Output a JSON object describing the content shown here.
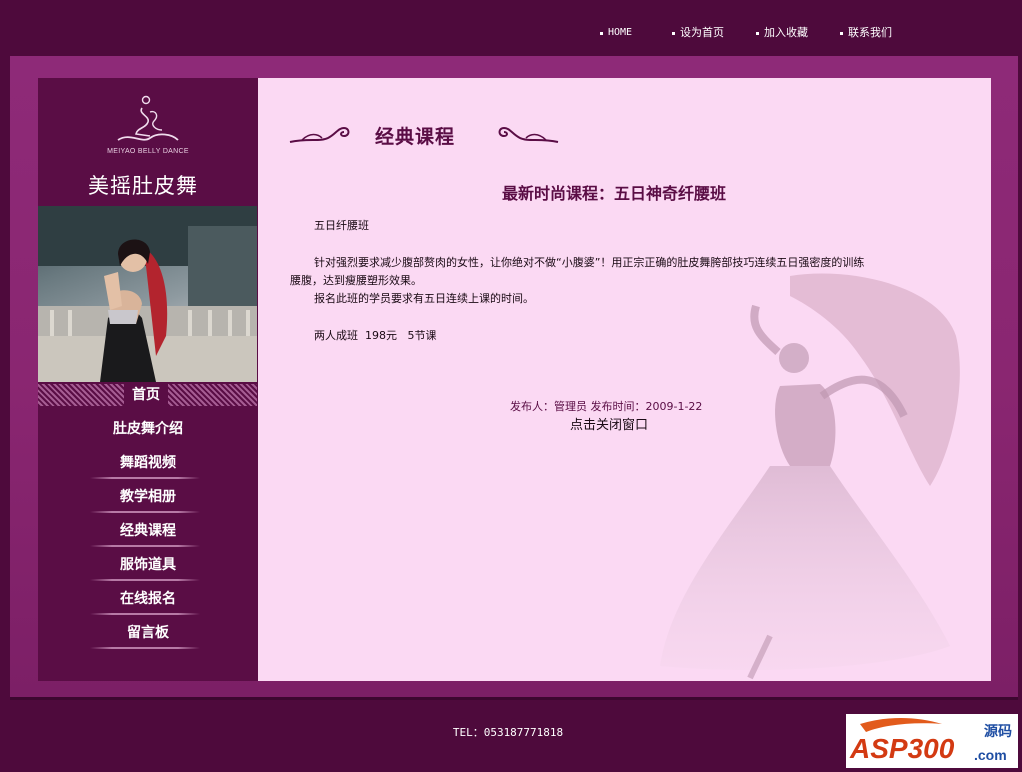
{
  "topnav": {
    "home": "HOME",
    "set_home": "设为首页",
    "favorite": "加入收藏",
    "contact": "联系我们"
  },
  "brand": {
    "logo_text": "MEIYAO BELLY DANCE",
    "title": "美摇肚皮舞"
  },
  "sidebar": {
    "home": "首页",
    "items": [
      {
        "label": "肚皮舞介绍"
      },
      {
        "label": "舞蹈视频"
      },
      {
        "label": "教学相册"
      },
      {
        "label": "经典课程"
      },
      {
        "label": "服饰道具"
      },
      {
        "label": "在线报名"
      },
      {
        "label": "留言板"
      }
    ]
  },
  "main": {
    "section_title": "经典课程",
    "article_title": "最新时尚课程：五日神奇纤腰班",
    "p1": "五日纤腰班",
    "p2a": "针对强烈要求减少腹部赘肉的女性，让你绝对不做“小腹婆”！用正宗正确的肚皮舞胯部技巧连续五日强密度的训练",
    "p2b": "腰腹，达到瘦腰塑形效果。",
    "p3": "报名此班的学员要求有五日连续上课的时间。",
    "p4": "两人成班  198元   5节课",
    "meta": "发布人：管理员 发布时间：2009-1-22",
    "close_link": "点击关闭窗口"
  },
  "footer": {
    "tel": "TEL：053187771818",
    "badge_main": "ASP300",
    "badge_sub": "源码",
    "badge_domain": ".com"
  },
  "colors": {
    "page_bg": "#4e0a3c",
    "frame": "#8a2671",
    "sidebar": "#5a0d45",
    "content_bg": "#fbd9f3",
    "heading": "#5a0d45"
  }
}
